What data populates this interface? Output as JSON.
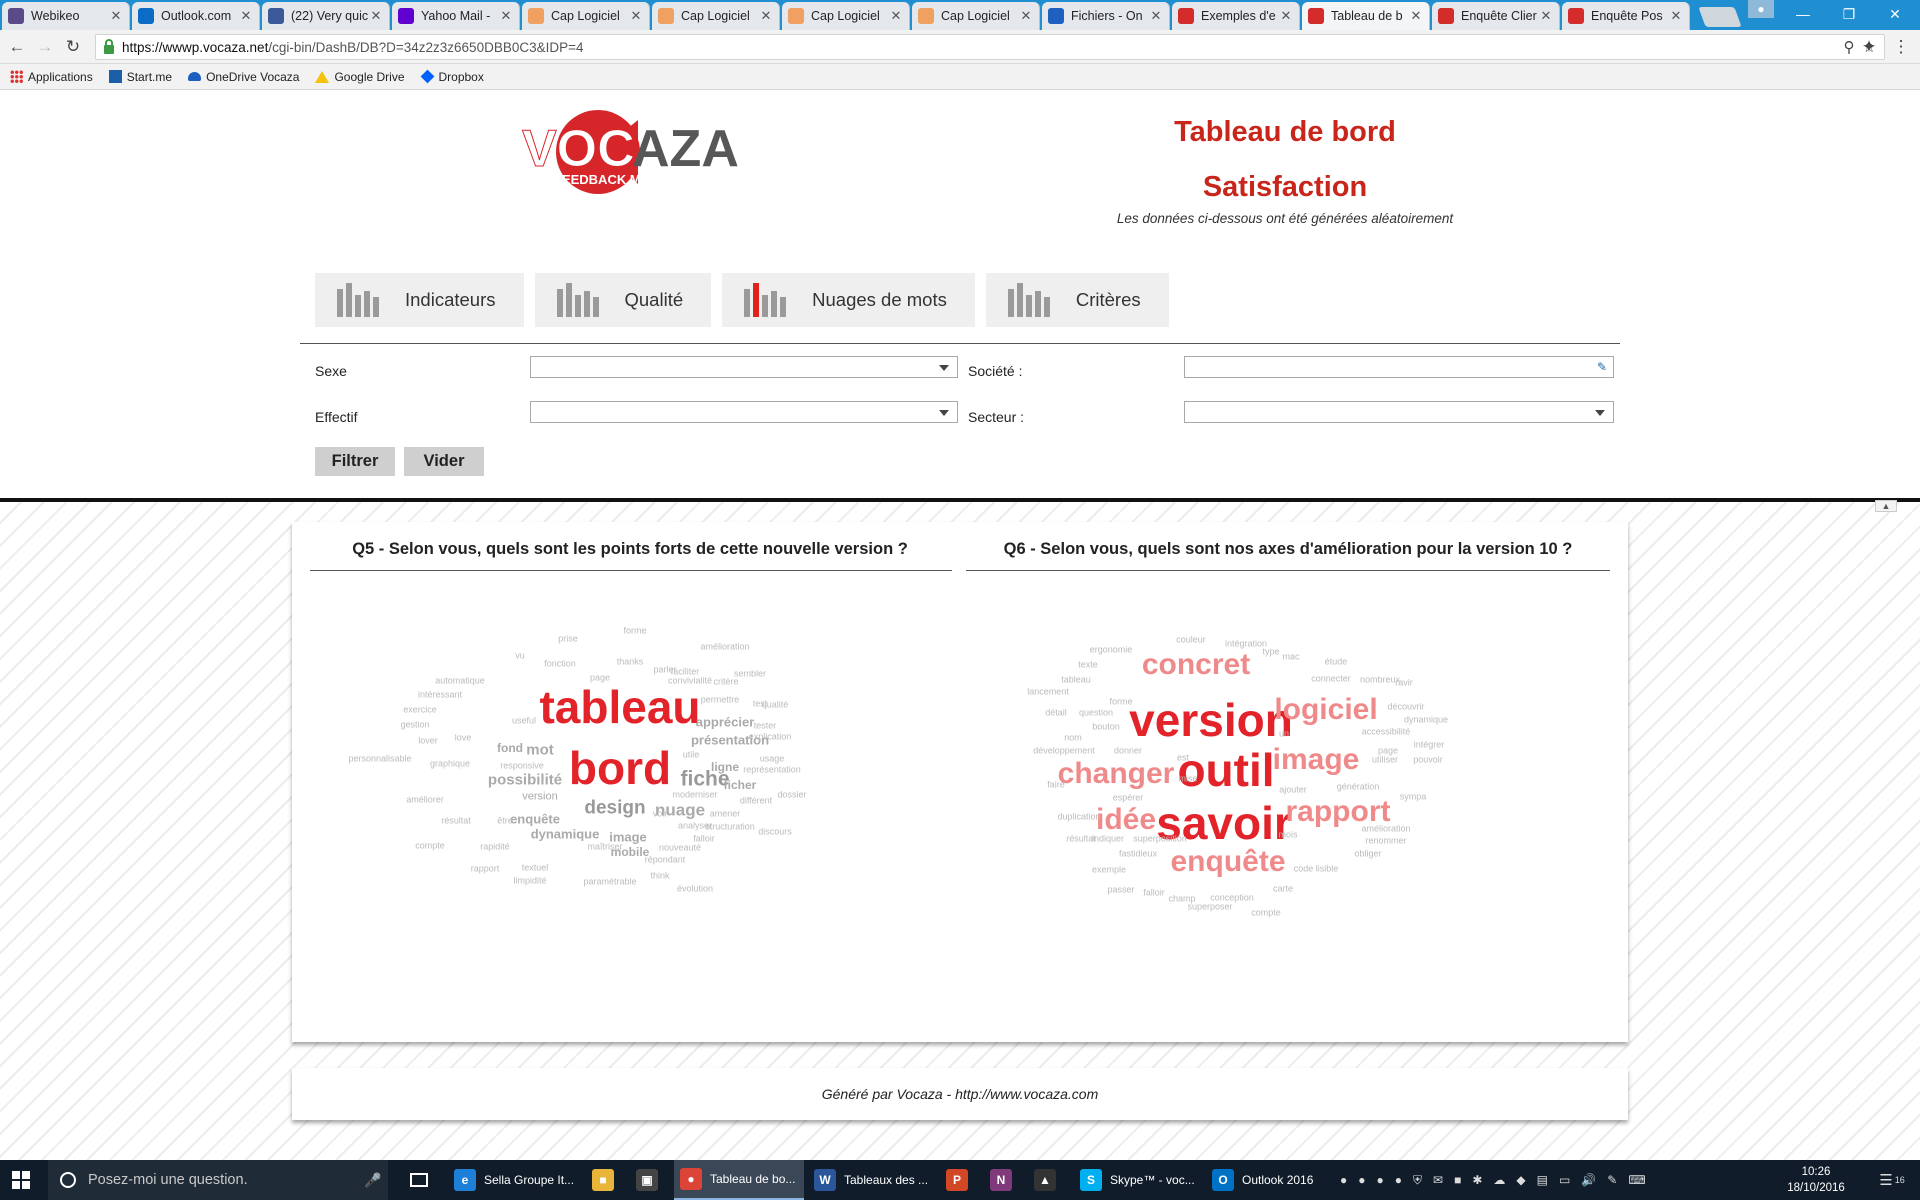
{
  "browser": {
    "tabs": [
      {
        "title": "Webikeo",
        "favicon": "webikeo-icon",
        "color": "#5b4a8a"
      },
      {
        "title": "Outlook.com",
        "favicon": "outlook-icon",
        "color": "#0a6cc4"
      },
      {
        "title": "(22) Very quic",
        "favicon": "facebook-icon",
        "color": "#3b5998"
      },
      {
        "title": "Yahoo Mail -",
        "favicon": "yahoo-icon",
        "color": "#6001d2"
      },
      {
        "title": "Cap Logiciel",
        "favicon": "cap-logiciel-icon",
        "color": "#f0a060"
      },
      {
        "title": "Cap Logiciel",
        "favicon": "cap-logiciel-icon",
        "color": "#f0a060"
      },
      {
        "title": "Cap Logiciel",
        "favicon": "cap-logiciel-icon",
        "color": "#f0a060"
      },
      {
        "title": "Cap Logiciel",
        "favicon": "cap-logiciel-icon",
        "color": "#f0a060"
      },
      {
        "title": "Fichiers - On",
        "favicon": "onedrive-icon",
        "color": "#1e60c0"
      },
      {
        "title": "Exemples d'e",
        "favicon": "vocaza-icon",
        "color": "#d42b2b"
      },
      {
        "title": "Tableau de b",
        "favicon": "vocaza-icon",
        "color": "#d42b2b",
        "active": true
      },
      {
        "title": "Enquête Clier",
        "favicon": "vocaza-icon",
        "color": "#d42b2b"
      },
      {
        "title": "Enquête Pos",
        "favicon": "vocaza-icon",
        "color": "#d42b2b"
      }
    ],
    "url_host": "https://wwwp.vocaza.net",
    "url_path": "/cgi-bin/DashB/DB?D=34z2z3z6650DBB0C3&IDP=4",
    "bookmarks": [
      "Applications",
      "Start.me",
      "OneDrive Vocaza",
      "Google Drive",
      "Dropbox"
    ]
  },
  "header": {
    "logo_text_voc": "VOC",
    "logo_text_aza": "AZA",
    "logo_tagline": "FEEDBACK MANAGEMENT",
    "title": "Tableau de bord",
    "subtitle_title": "Satisfaction",
    "note": "Les données ci-dessous ont été générées aléatoirement"
  },
  "nav": {
    "tabs": [
      "Indicateurs",
      "Qualité",
      "Nuages de mots",
      "Critères"
    ],
    "active_index": 2,
    "accent": "#e1211c"
  },
  "filters": {
    "sexe_label": "Sexe",
    "effectif_label": "Effectif",
    "societe_label": "Société :",
    "secteur_label": "Secteur :",
    "filter_button": "Filtrer",
    "clear_button": "Vider"
  },
  "clouds": {
    "q5_title": "Q5 - Selon vous, quels sont les points forts de cette nouvelle version ?",
    "q6_title": "Q6 - Selon vous, quels sont nos axes d'amélioration pour la version 10 ?",
    "q5_words": [
      {
        "t": "tableau",
        "s": 46,
        "c": "#e3232a"
      },
      {
        "t": "bord",
        "s": 46,
        "c": "#e3232a"
      },
      {
        "t": "fiche",
        "s": 21,
        "c": "#999"
      },
      {
        "t": "design",
        "s": 19,
        "c": "#999"
      },
      {
        "t": "nuage",
        "s": 17,
        "c": "#aaa"
      },
      {
        "t": "possibilité",
        "s": 15,
        "c": "#aaa"
      },
      {
        "t": "mot",
        "s": 15,
        "c": "#aaa"
      },
      {
        "t": "apprécier",
        "s": 13,
        "c": "#aaa"
      },
      {
        "t": "présentation",
        "s": 13,
        "c": "#aaa"
      },
      {
        "t": "enquête",
        "s": 13,
        "c": "#aaa"
      },
      {
        "t": "dynamique",
        "s": 13,
        "c": "#aaa"
      },
      {
        "t": "image",
        "s": 13,
        "c": "#aaa"
      },
      {
        "t": "fond",
        "s": 12,
        "c": "#aaa"
      },
      {
        "t": "ligne",
        "s": 12,
        "c": "#aaa"
      },
      {
        "t": "ficher",
        "s": 12,
        "c": "#aaa"
      },
      {
        "t": "mobile",
        "s": 12,
        "c": "#aaa"
      },
      {
        "t": "version",
        "s": 11,
        "c": "#aaa"
      },
      {
        "t": "prise",
        "s": 9,
        "c": "#bbb"
      },
      {
        "t": "forme",
        "s": 9,
        "c": "#bbb"
      },
      {
        "t": "vu",
        "s": 9,
        "c": "#bbb"
      },
      {
        "t": "amélioration",
        "s": 9,
        "c": "#bbb"
      },
      {
        "t": "fonction",
        "s": 9,
        "c": "#bbb"
      },
      {
        "t": "thanks",
        "s": 9,
        "c": "#bbb"
      },
      {
        "t": "page",
        "s": 9,
        "c": "#bbb"
      },
      {
        "t": "parler",
        "s": 9,
        "c": "#bbb"
      },
      {
        "t": "sembler",
        "s": 9,
        "c": "#bbb"
      },
      {
        "t": "faciliter",
        "s": 9,
        "c": "#bbb"
      },
      {
        "t": "automatique",
        "s": 9,
        "c": "#bbb"
      },
      {
        "t": "convivialité",
        "s": 9,
        "c": "#bbb"
      },
      {
        "t": "critère",
        "s": 9,
        "c": "#bbb"
      },
      {
        "t": "intéressant",
        "s": 9,
        "c": "#bbb"
      },
      {
        "t": "permettre",
        "s": 9,
        "c": "#bbb"
      },
      {
        "t": "test",
        "s": 9,
        "c": "#bbb"
      },
      {
        "t": "exercice",
        "s": 9,
        "c": "#bbb"
      },
      {
        "t": "qualité",
        "s": 9,
        "c": "#bbb"
      },
      {
        "t": "gestion",
        "s": 9,
        "c": "#bbb"
      },
      {
        "t": "useful",
        "s": 9,
        "c": "#bbb"
      },
      {
        "t": "tester",
        "s": 9,
        "c": "#bbb"
      },
      {
        "t": "love",
        "s": 9,
        "c": "#bbb"
      },
      {
        "t": "explication",
        "s": 9,
        "c": "#bbb"
      },
      {
        "t": "lover",
        "s": 9,
        "c": "#bbb"
      },
      {
        "t": "utile",
        "s": 9,
        "c": "#bbb"
      },
      {
        "t": "usage",
        "s": 9,
        "c": "#bbb"
      },
      {
        "t": "personnalisable",
        "s": 9,
        "c": "#bbb"
      },
      {
        "t": "graphique",
        "s": 9,
        "c": "#bbb"
      },
      {
        "t": "responsive",
        "s": 9,
        "c": "#bbb"
      },
      {
        "t": "représentation",
        "s": 9,
        "c": "#bbb"
      },
      {
        "t": "améliorer",
        "s": 9,
        "c": "#bbb"
      },
      {
        "t": "moderniser",
        "s": 9,
        "c": "#bbb"
      },
      {
        "t": "dossier",
        "s": 9,
        "c": "#bbb"
      },
      {
        "t": "différent",
        "s": 9,
        "c": "#bbb"
      },
      {
        "t": "résultat",
        "s": 9,
        "c": "#bbb"
      },
      {
        "t": "être",
        "s": 9,
        "c": "#bbb"
      },
      {
        "t": "voir",
        "s": 9,
        "c": "#bbb"
      },
      {
        "t": "amener",
        "s": 9,
        "c": "#bbb"
      },
      {
        "t": "analyser",
        "s": 9,
        "c": "#bbb"
      },
      {
        "t": "structuration",
        "s": 9,
        "c": "#bbb"
      },
      {
        "t": "discours",
        "s": 9,
        "c": "#bbb"
      },
      {
        "t": "compte",
        "s": 9,
        "c": "#bbb"
      },
      {
        "t": "rapidité",
        "s": 9,
        "c": "#bbb"
      },
      {
        "t": "maîtriser",
        "s": 9,
        "c": "#bbb"
      },
      {
        "t": "falloir",
        "s": 9,
        "c": "#bbb"
      },
      {
        "t": "nouveauté",
        "s": 9,
        "c": "#bbb"
      },
      {
        "t": "répondant",
        "s": 9,
        "c": "#bbb"
      },
      {
        "t": "rapport",
        "s": 9,
        "c": "#bbb"
      },
      {
        "t": "textuel",
        "s": 9,
        "c": "#bbb"
      },
      {
        "t": "think",
        "s": 9,
        "c": "#bbb"
      },
      {
        "t": "limpidité",
        "s": 9,
        "c": "#bbb"
      },
      {
        "t": "paramétrable",
        "s": 9,
        "c": "#bbb"
      },
      {
        "t": "évolution",
        "s": 9,
        "c": "#bbb"
      }
    ],
    "q6_words": [
      {
        "t": "version",
        "s": 46,
        "c": "#e3232a"
      },
      {
        "t": "outil",
        "s": 46,
        "c": "#e3232a"
      },
      {
        "t": "savoir",
        "s": 46,
        "c": "#e3232a"
      },
      {
        "t": "concret",
        "s": 30,
        "c": "#f08a8a"
      },
      {
        "t": "logiciel",
        "s": 30,
        "c": "#f08a8a"
      },
      {
        "t": "image",
        "s": 30,
        "c": "#f08a8a"
      },
      {
        "t": "changer",
        "s": 30,
        "c": "#f08a8a"
      },
      {
        "t": "idée",
        "s": 30,
        "c": "#f08a8a"
      },
      {
        "t": "rapport",
        "s": 30,
        "c": "#f08a8a"
      },
      {
        "t": "enquête",
        "s": 30,
        "c": "#f08a8a"
      },
      {
        "t": "couleur",
        "s": 9,
        "c": "#bbb"
      },
      {
        "t": "intégration",
        "s": 9,
        "c": "#bbb"
      },
      {
        "t": "ergonomie",
        "s": 9,
        "c": "#bbb"
      },
      {
        "t": "type",
        "s": 9,
        "c": "#bbb"
      },
      {
        "t": "mac",
        "s": 9,
        "c": "#bbb"
      },
      {
        "t": "texte",
        "s": 9,
        "c": "#bbb"
      },
      {
        "t": "étude",
        "s": 9,
        "c": "#bbb"
      },
      {
        "t": "tableau",
        "s": 9,
        "c": "#bbb"
      },
      {
        "t": "connecter",
        "s": 9,
        "c": "#bbb"
      },
      {
        "t": "nombreux",
        "s": 9,
        "c": "#bbb"
      },
      {
        "t": "ravir",
        "s": 9,
        "c": "#bbb"
      },
      {
        "t": "lancement",
        "s": 9,
        "c": "#bbb"
      },
      {
        "t": "forme",
        "s": 9,
        "c": "#bbb"
      },
      {
        "t": "découvrir",
        "s": 9,
        "c": "#bbb"
      },
      {
        "t": "détail",
        "s": 9,
        "c": "#bbb"
      },
      {
        "t": "question",
        "s": 9,
        "c": "#bbb"
      },
      {
        "t": "dynamique",
        "s": 9,
        "c": "#bbb"
      },
      {
        "t": "bouton",
        "s": 9,
        "c": "#bbb"
      },
      {
        "t": "un",
        "s": 9,
        "c": "#bbb"
      },
      {
        "t": "accessibilité",
        "s": 9,
        "c": "#bbb"
      },
      {
        "t": "nom",
        "s": 9,
        "c": "#bbb"
      },
      {
        "t": "intégrer",
        "s": 9,
        "c": "#bbb"
      },
      {
        "t": "développement",
        "s": 9,
        "c": "#bbb"
      },
      {
        "t": "donner",
        "s": 9,
        "c": "#bbb"
      },
      {
        "t": "page",
        "s": 9,
        "c": "#bbb"
      },
      {
        "t": "est",
        "s": 9,
        "c": "#bbb"
      },
      {
        "t": "utiliser",
        "s": 9,
        "c": "#bbb"
      },
      {
        "t": "pouvoir",
        "s": 9,
        "c": "#bbb"
      },
      {
        "t": "faire",
        "s": 9,
        "c": "#bbb"
      },
      {
        "t": "mise",
        "s": 9,
        "c": "#bbb"
      },
      {
        "t": "génération",
        "s": 9,
        "c": "#bbb"
      },
      {
        "t": "ajouter",
        "s": 9,
        "c": "#bbb"
      },
      {
        "t": "espérer",
        "s": 9,
        "c": "#bbb"
      },
      {
        "t": "sympa",
        "s": 9,
        "c": "#bbb"
      },
      {
        "t": "duplication",
        "s": 9,
        "c": "#bbb"
      },
      {
        "t": "amélioration",
        "s": 9,
        "c": "#bbb"
      },
      {
        "t": "mois",
        "s": 9,
        "c": "#bbb"
      },
      {
        "t": "résultat",
        "s": 9,
        "c": "#bbb"
      },
      {
        "t": "indiquer",
        "s": 9,
        "c": "#bbb"
      },
      {
        "t": "superposition",
        "s": 9,
        "c": "#bbb"
      },
      {
        "t": "renommer",
        "s": 9,
        "c": "#bbb"
      },
      {
        "t": "fastidieux",
        "s": 9,
        "c": "#bbb"
      },
      {
        "t": "obliger",
        "s": 9,
        "c": "#bbb"
      },
      {
        "t": "exemple",
        "s": 9,
        "c": "#bbb"
      },
      {
        "t": "code lisible",
        "s": 9,
        "c": "#bbb"
      },
      {
        "t": "carte",
        "s": 9,
        "c": "#bbb"
      },
      {
        "t": "passer",
        "s": 9,
        "c": "#bbb"
      },
      {
        "t": "falloir",
        "s": 9,
        "c": "#bbb"
      },
      {
        "t": "champ",
        "s": 9,
        "c": "#bbb"
      },
      {
        "t": "conception",
        "s": 9,
        "c": "#bbb"
      },
      {
        "t": "superposer",
        "s": 9,
        "c": "#bbb"
      },
      {
        "t": "compte",
        "s": 9,
        "c": "#bbb"
      }
    ]
  },
  "footer": {
    "text": "Généré par Vocaza - http://www.vocaza.com"
  },
  "taskbar": {
    "search_placeholder": "Posez-moi une question.",
    "apps": [
      {
        "label": "Sella Groupe It...",
        "icon": "edge-icon",
        "color": "#1e7fd6"
      },
      {
        "label": "",
        "icon": "explorer-icon",
        "color": "#e8b43a"
      },
      {
        "label": "",
        "icon": "store-icon",
        "color": "#444"
      },
      {
        "label": "Tableau de bo...",
        "icon": "chrome-icon",
        "color": "#db4437",
        "active": true
      },
      {
        "label": "Tableaux des ...",
        "icon": "word-icon",
        "color": "#2b579a"
      },
      {
        "label": "",
        "icon": "powerpoint-icon",
        "color": "#d24726"
      },
      {
        "label": "",
        "icon": "onenote-icon",
        "color": "#80397b"
      },
      {
        "label": "",
        "icon": "photos-icon",
        "color": "#333"
      },
      {
        "label": "Skype™ - voc...",
        "icon": "skype-icon",
        "color": "#00aff0"
      },
      {
        "label": "Outlook 2016",
        "icon": "outlook-icon",
        "color": "#0072c6"
      }
    ],
    "time": "10:26",
    "date": "18/10/2016",
    "notif_count": "16"
  }
}
